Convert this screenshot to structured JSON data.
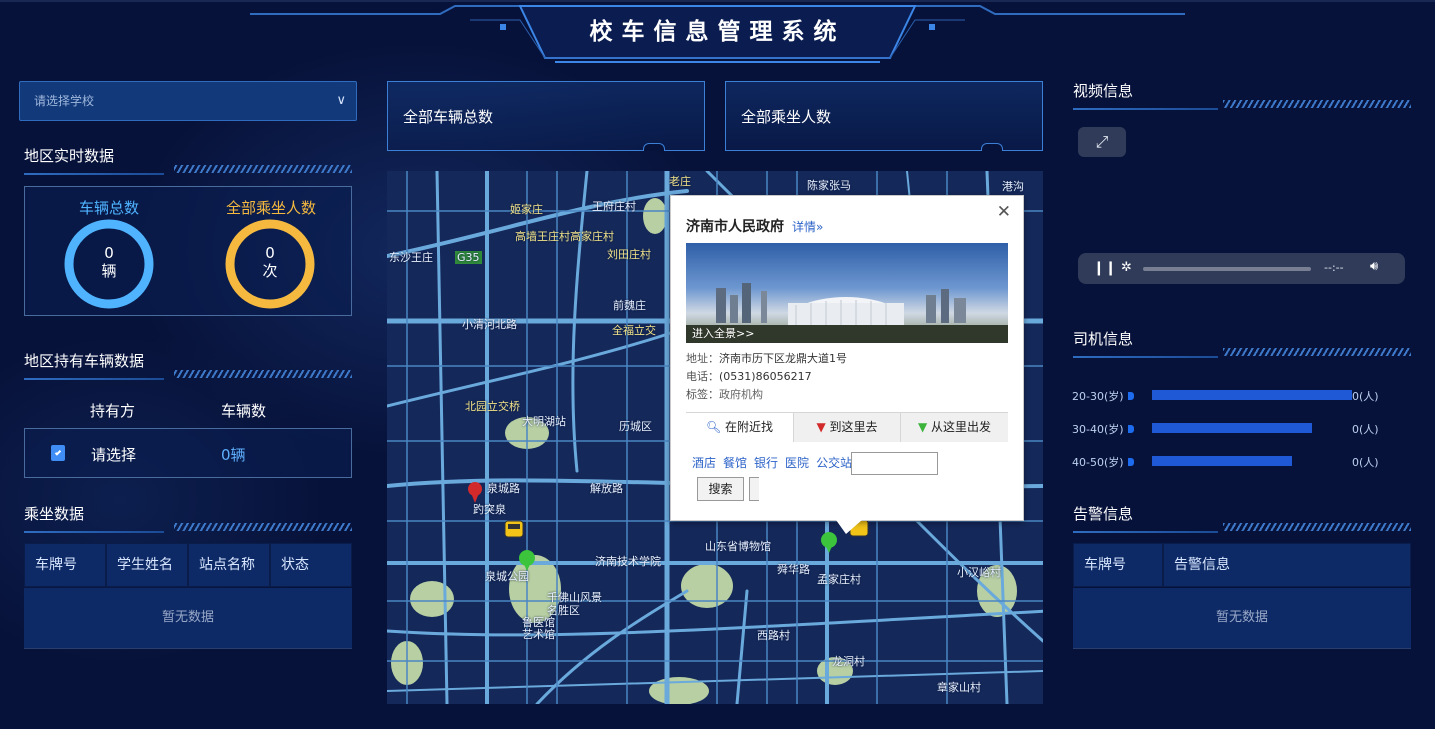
{
  "header": {
    "title": "校车信息管理系统"
  },
  "left": {
    "school_select": {
      "placeholder": "请选择学校",
      "chevron": "chevron-down-icon"
    },
    "region_realtime": {
      "title": "地区实时数据",
      "vehicles": {
        "label": "车辆总数",
        "value": "0",
        "unit": "辆",
        "color": "#4fb3ff"
      },
      "riders": {
        "label": "全部乘坐人数",
        "value": "0",
        "unit": "次",
        "color": "#f5b93f"
      }
    },
    "region_vehicles": {
      "title": "地区持有车辆数据",
      "col_owner": "持有方",
      "col_count": "车辆数",
      "row_owner": "请选择",
      "row_count": "0辆",
      "icon": "clipboard-icon"
    },
    "ride_data": {
      "title": "乘坐数据",
      "columns": [
        "车牌号",
        "学生姓名",
        "站点名称",
        "状态"
      ],
      "empty": "暂无数据"
    }
  },
  "middle": {
    "card_total_vehicles": "全部车辆总数",
    "card_total_riders": "全部乘坐人数",
    "map": {
      "labels": {
        "l1": "老庄",
        "l2": "陈家张马",
        "l3": "姬家庄",
        "l4": "王府庄村",
        "l5": "高墙王庄村高家庄村",
        "l6": "刘田庄村",
        "l7": "前魏庄",
        "l8": "全福立交",
        "l9": "小清河北路",
        "l10": "北园立交桥",
        "l11": "大明湖站",
        "l12": "历城区",
        "l13": "泉城路",
        "l14": "解放路",
        "l15": "泉城公园",
        "l16": "千佛山风景名胜区",
        "l17": "山东省博物馆",
        "l18": "济南技术学院",
        "l19": "舜华路",
        "l20": "孟家庄村",
        "l21": "西路村",
        "l22": "龙洞村",
        "l23": "章家山村",
        "l24": "小汉峪村",
        "l25": "港沟",
        "l26": "G35",
        "l27": "东沙王庄",
        "l28": "鲁医馆",
        "l29": "艺术馆",
        "l30": "趵突泉"
      },
      "popup": {
        "title": "济南市人民政府",
        "detail": "详情»",
        "photo_caption": "进入全景>>",
        "address_key": "地址：",
        "address": "济南市历下区龙鼎大道1号",
        "phone_key": "电话：",
        "phone": "(0531)86056217",
        "tag_key": "标签：",
        "tag": "政府机构",
        "tab_nearby": "在附近找",
        "tab_to": "到这里去",
        "tab_from": "从这里出发",
        "links": [
          "酒店",
          "餐馆",
          "银行",
          "医院",
          "公交站"
        ],
        "search_button": "搜索"
      }
    }
  },
  "right": {
    "video": {
      "title": "视频信息",
      "time": "--:--"
    },
    "driver": {
      "title": "司机信息",
      "rows": [
        {
          "range": "20-30(岁)",
          "value": "0(人)",
          "share": 1.0
        },
        {
          "range": "30-40(岁)",
          "value": "0(人)",
          "share": 0.8
        },
        {
          "range": "40-50(岁)",
          "value": "0(人)",
          "share": 0.7
        }
      ]
    },
    "alarm": {
      "title": "告警信息",
      "columns": [
        "车牌号",
        "告警信息"
      ],
      "empty": "暂无数据"
    }
  }
}
